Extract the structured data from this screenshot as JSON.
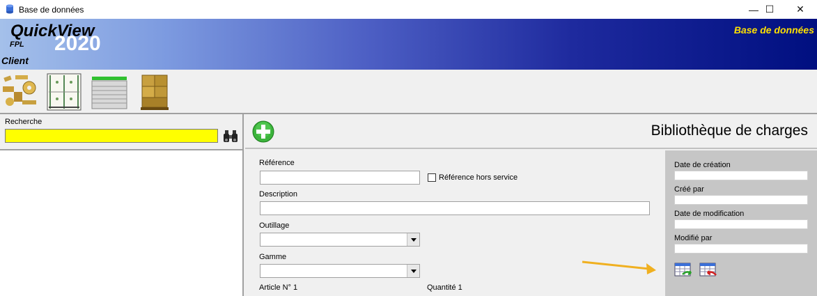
{
  "window": {
    "title": "Base de données",
    "controls": {
      "minimize": "—",
      "maximize": "☐",
      "close": "✕"
    }
  },
  "banner": {
    "brand": "QuickView",
    "sub": "FPL",
    "year": "2020",
    "role": "Client",
    "right_title": "Base de données",
    "accent": "#ffe000"
  },
  "toolbar": {
    "buttons": [
      {
        "name": "loads-library-icon"
      },
      {
        "name": "rack-icon"
      },
      {
        "name": "program-list-icon"
      },
      {
        "name": "pallet-icon"
      }
    ]
  },
  "search": {
    "label": "Recherche",
    "value": "",
    "bg_color": "#ffff00"
  },
  "main": {
    "title": "Bibliothèque de charges",
    "add_icon": "add-circle-icon"
  },
  "form": {
    "reference_label": "Référence",
    "reference_value": "",
    "out_of_service_label": "Référence hors service",
    "description_label": "Description",
    "outillage_label": "Outillage",
    "gamme_label": "Gamme",
    "article_label": "Article N° 1",
    "quantite_label": "Quantité 1"
  },
  "audit": {
    "created_date_label": "Date de création",
    "created_by_label": "Créé par",
    "modified_date_label": "Date de modification",
    "modified_by_label": "Modifié par"
  }
}
